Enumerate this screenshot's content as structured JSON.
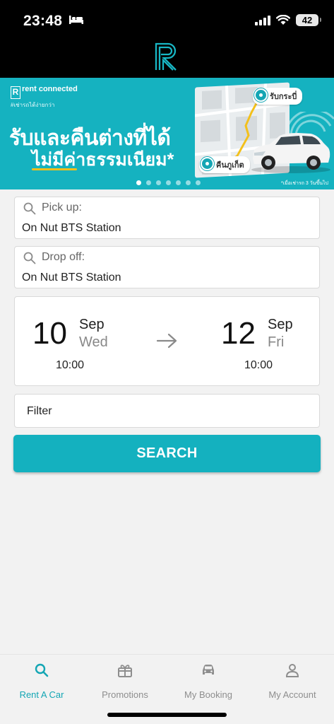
{
  "status_bar": {
    "time": "23:48",
    "battery": "42"
  },
  "banner": {
    "brand_mark": "R",
    "brand_name": "rent connected",
    "brand_tag": "#เช่ารถได้ง่ายกว่า",
    "headline_1": "รับและคืนต่างที่ได้",
    "headline_2": "ไม่มีค่าธรรมเนียม*",
    "pickup_label": "รับกระบี่",
    "return_label": "คืนภูเก็ต",
    "note": "*เมื่อเช่ารถ 3 วันขึ้นไป",
    "slides": 7,
    "active_slide": 0
  },
  "pickup": {
    "label": "Pick up:",
    "value": "On Nut BTS Station"
  },
  "dropoff": {
    "label": "Drop off:",
    "value": "On Nut BTS Station"
  },
  "dates": {
    "start": {
      "day": "10",
      "month": "Sep",
      "weekday": "Wed",
      "time": "10:00"
    },
    "end": {
      "day": "12",
      "month": "Sep",
      "weekday": "Fri",
      "time": "10:00"
    }
  },
  "filter": {
    "label": "Filter"
  },
  "search_button": {
    "label": "SEARCH"
  },
  "tabs": [
    {
      "label": "Rent A Car",
      "icon": "search-icon",
      "active": true
    },
    {
      "label": "Promotions",
      "icon": "gift-icon",
      "active": false
    },
    {
      "label": "My Booking",
      "icon": "car-icon",
      "active": false
    },
    {
      "label": "My Account",
      "icon": "user-icon",
      "active": false
    }
  ],
  "colors": {
    "accent": "#14b1bf",
    "banner": "#15b2c0",
    "underline": "#f3c01b"
  }
}
